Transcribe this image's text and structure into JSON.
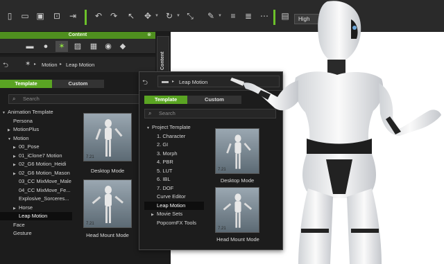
{
  "toolbar": {
    "quality": "High"
  },
  "content_panel": {
    "title": "Content",
    "side_tab": "Content",
    "breadcrumb": [
      "Motion",
      "Leap Motion"
    ],
    "tabs": [
      "Template",
      "Custom"
    ],
    "search_placeholder": "Search",
    "tree": [
      {
        "label": "Animation Template",
        "level": 0,
        "expanded": true
      },
      {
        "label": "Persona",
        "level": 1
      },
      {
        "label": "MotionPlus",
        "level": 1,
        "collapsed": true
      },
      {
        "label": "Motion",
        "level": 1,
        "expanded": true
      },
      {
        "label": "00_Pose",
        "level": 2,
        "collapsed": true
      },
      {
        "label": "01_iClone7 Motion",
        "level": 2,
        "collapsed": true
      },
      {
        "label": "02_G6 Motion_Heidi",
        "level": 2,
        "collapsed": true
      },
      {
        "label": "02_G6 Motion_Mason",
        "level": 2,
        "collapsed": true
      },
      {
        "label": "03_CC MixMove_Male",
        "level": 2
      },
      {
        "label": "04_CC MixMove_Fe...",
        "level": 2
      },
      {
        "label": "Explosive_Sorceres...",
        "level": 2
      },
      {
        "label": "Horse",
        "level": 2,
        "collapsed": true
      },
      {
        "label": "Leap Motion",
        "level": 2,
        "selected": true
      },
      {
        "label": "Face",
        "level": 1
      },
      {
        "label": "Gesture",
        "level": 1
      }
    ],
    "thumbnails": [
      {
        "label": "Desktop Mode",
        "num": "7.21"
      },
      {
        "label": "Head Mount Mode",
        "num": "7.21"
      }
    ]
  },
  "leap_panel": {
    "breadcrumb": "Leap Motion",
    "tabs": [
      "Template",
      "Custom"
    ],
    "search_placeholder": "Search",
    "tree": [
      {
        "label": "Project Template",
        "level": 0,
        "expanded": true
      },
      {
        "label": "1. Character",
        "level": 1
      },
      {
        "label": "2. GI",
        "level": 1
      },
      {
        "label": "3. Morph",
        "level": 1
      },
      {
        "label": "4. PBR",
        "level": 1
      },
      {
        "label": "5. LUT",
        "level": 1
      },
      {
        "label": "6. IBL",
        "level": 1
      },
      {
        "label": "7. DOF",
        "level": 1
      },
      {
        "label": "Curve Editor",
        "level": 1
      },
      {
        "label": "Leap Motion",
        "level": 1,
        "selected": true
      },
      {
        "label": "Movie Sets",
        "level": 1,
        "collapsed": true
      },
      {
        "label": "PopcornFX Tools",
        "level": 1
      }
    ],
    "thumbnails": [
      {
        "label": "Desktop Mode",
        "num": "7.21"
      },
      {
        "label": "Head Mount Mode",
        "num": "7.21"
      }
    ]
  },
  "colors": {
    "accent": "#5aa423",
    "panel": "#1c1c1c",
    "toolbar": "#2a2a2a",
    "robot": "#ececec"
  }
}
